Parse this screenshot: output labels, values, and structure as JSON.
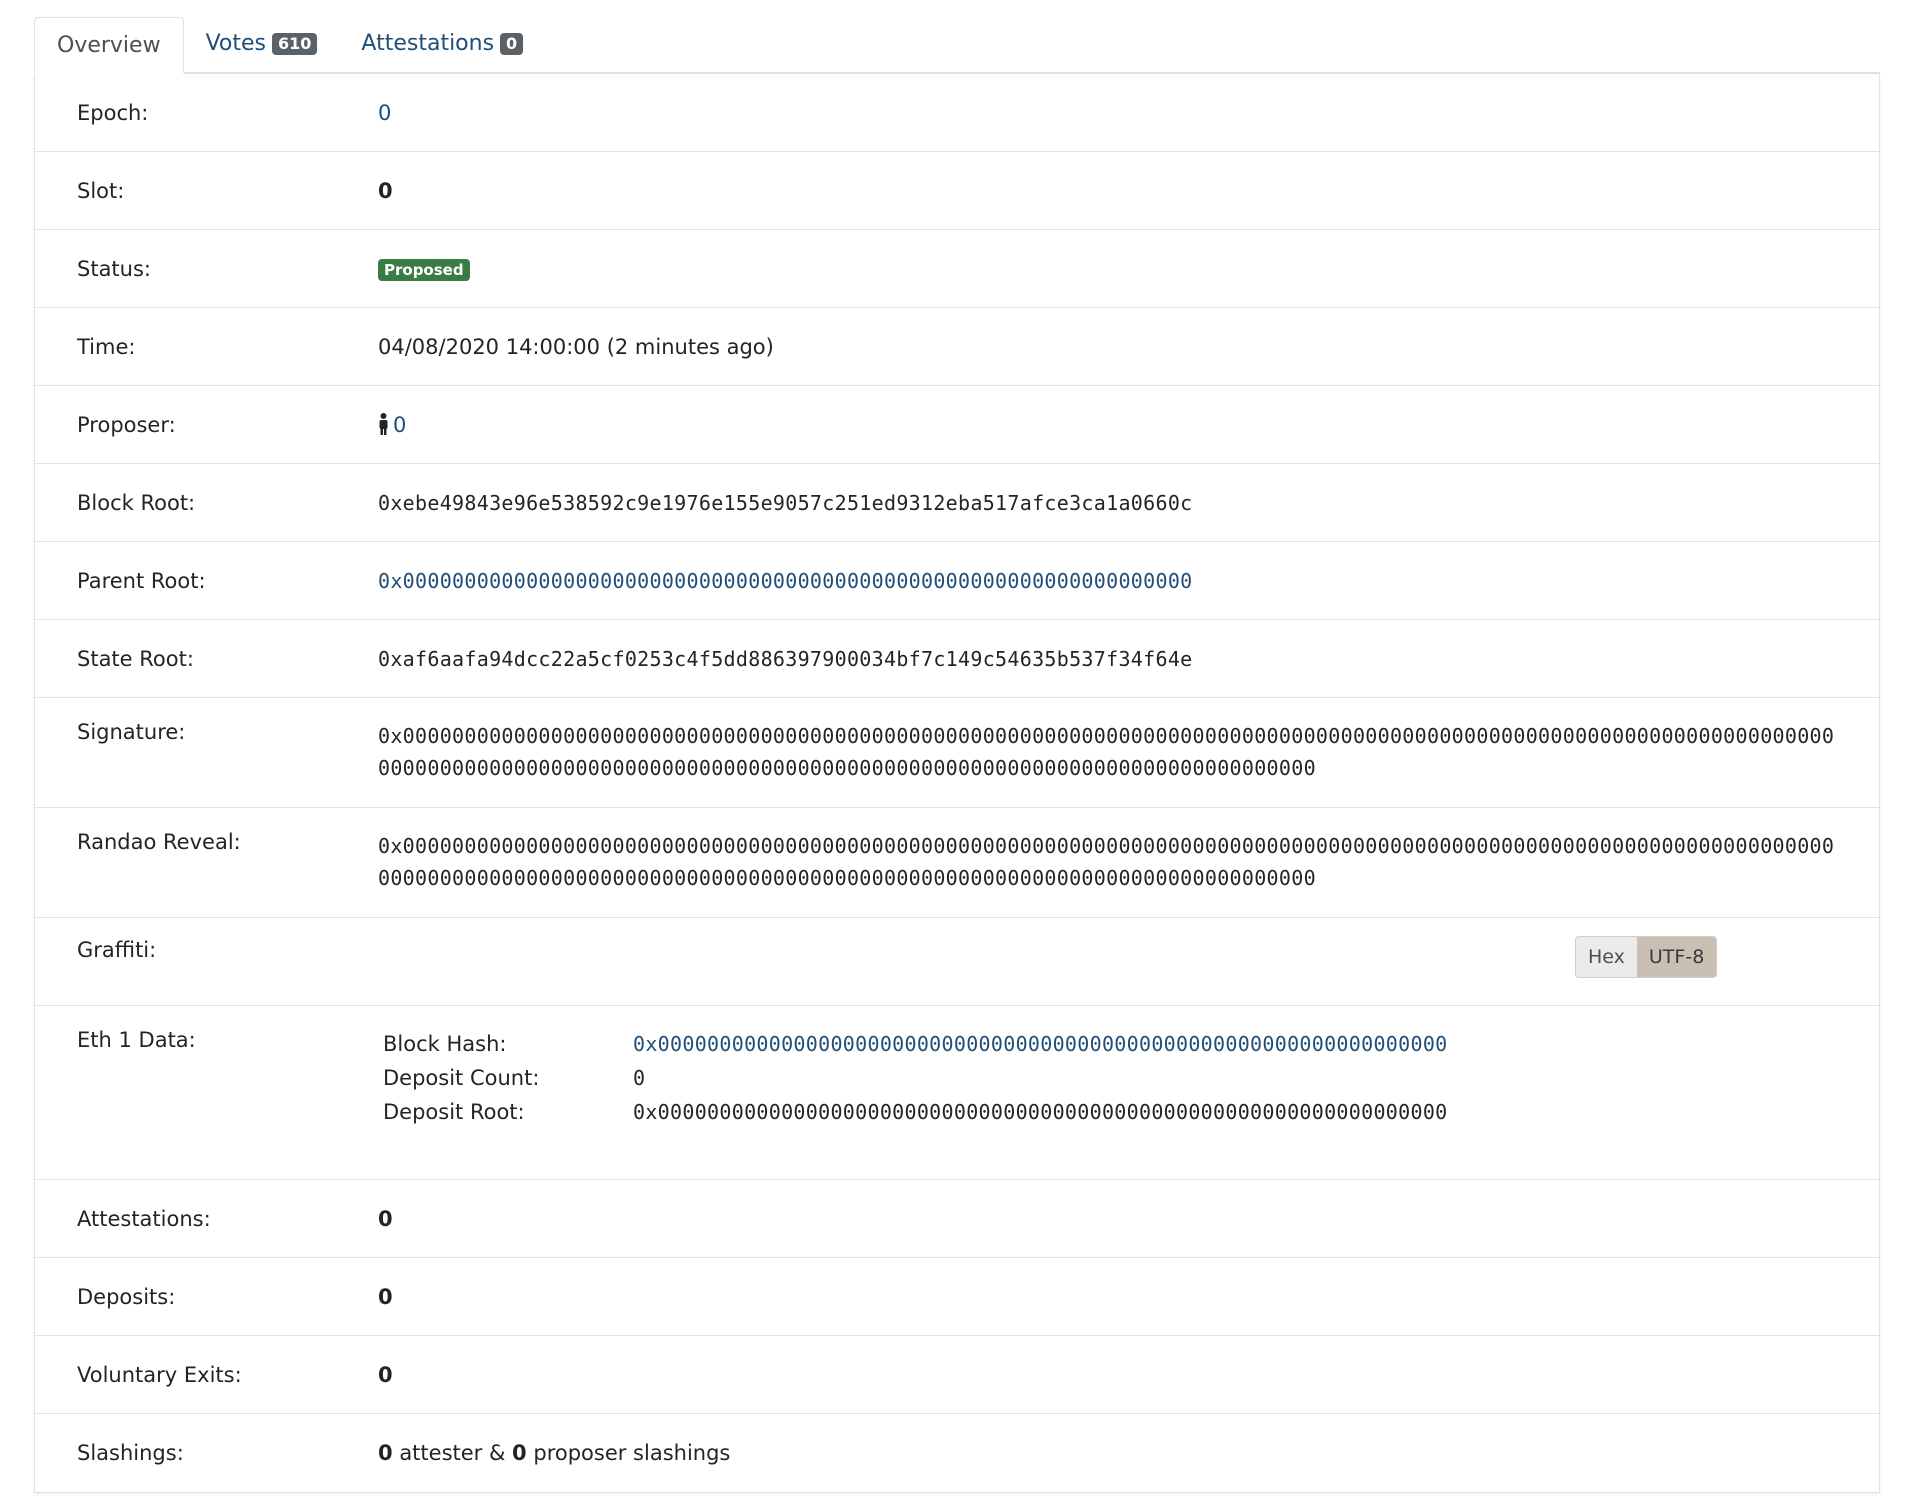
{
  "tabs": [
    {
      "label": "Overview",
      "badge": null,
      "active": true
    },
    {
      "label": "Votes",
      "badge": "610",
      "active": false
    },
    {
      "label": "Attestations",
      "badge": "0",
      "active": false
    }
  ],
  "details": {
    "epoch": {
      "label": "Epoch:",
      "value": "0"
    },
    "slot": {
      "label": "Slot:",
      "value": "0"
    },
    "status": {
      "label": "Status:",
      "value": "Proposed"
    },
    "time": {
      "label": "Time:",
      "value": "04/08/2020 14:00:00 (2 minutes ago)"
    },
    "proposer": {
      "label": "Proposer:",
      "value": "0"
    },
    "block_root": {
      "label": "Block Root:",
      "value": "0xebe49843e96e538592c9e1976e155e9057c251ed9312eba517afce3ca1a0660c"
    },
    "parent_root": {
      "label": "Parent Root:",
      "value": "0x0000000000000000000000000000000000000000000000000000000000000000"
    },
    "state_root": {
      "label": "State Root:",
      "value": "0xaf6aafa94dcc22a5cf0253c4f5dd886397900034bf7c149c54635b537f34f64e"
    },
    "signature": {
      "label": "Signature:",
      "value": "0x000000000000000000000000000000000000000000000000000000000000000000000000000000000000000000000000000000000000000000000000000000000000000000000000000000000000000000000000000000000000000000000000"
    },
    "randao_reveal": {
      "label": "Randao Reveal:",
      "value": "0x000000000000000000000000000000000000000000000000000000000000000000000000000000000000000000000000000000000000000000000000000000000000000000000000000000000000000000000000000000000000000000000000"
    },
    "graffiti": {
      "label": "Graffiti:",
      "hex_label": "Hex",
      "utf8_label": "UTF-8"
    },
    "eth1": {
      "label": "Eth 1 Data:",
      "block_hash_label": "Block Hash:",
      "block_hash": "0x0000000000000000000000000000000000000000000000000000000000000000",
      "deposit_count_label": "Deposit Count:",
      "deposit_count": "0",
      "deposit_root_label": "Deposit Root:",
      "deposit_root": "0x0000000000000000000000000000000000000000000000000000000000000000"
    },
    "attestations": {
      "label": "Attestations:",
      "value": "0"
    },
    "deposits": {
      "label": "Deposits:",
      "value": "0"
    },
    "voluntary_exits": {
      "label": "Voluntary Exits:",
      "value": "0"
    },
    "slashings": {
      "label": "Slashings:",
      "attester_count": "0",
      "attester_text": "attester &",
      "proposer_count": "0",
      "proposer_text": "proposer slashings"
    }
  }
}
